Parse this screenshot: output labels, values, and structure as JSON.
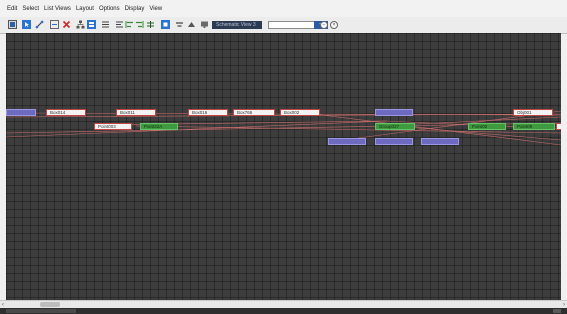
{
  "menu": [
    "Edit",
    "Select",
    "List Views",
    "Layout",
    "Options",
    "Display",
    "View"
  ],
  "toolbar": {
    "view_name": "Schematic View 3",
    "view_select_value": "",
    "icons": [
      "display-floater-icon",
      "select-icon",
      "connect-icon",
      "unlink-icon",
      "delete-icon",
      "hierarchy-mode-icon",
      "references-mode-icon",
      "move-children-icon",
      "align-icon",
      "align-left-icon",
      "align-right-icon",
      "arrange-children-icon",
      "shrink-icon",
      "grow-icon",
      "preferences-icon"
    ]
  },
  "colors": {
    "canvas_bg": "#3d3d3d",
    "wire": "#c46a6a",
    "node_white": "#f3f3f3",
    "node_green": "#3f9a3f",
    "node_purple": "#6d6ac0"
  },
  "nodes": [
    {
      "label": "Box014",
      "type": "white"
    },
    {
      "label": "Box011",
      "type": "white"
    },
    {
      "label": "Box016",
      "type": "white"
    },
    {
      "label": "Box766",
      "type": "white"
    },
    {
      "label": "Box002",
      "type": "white"
    },
    {
      "label": "Obj001",
      "type": "white"
    },
    {
      "label": "Point003",
      "type": "white"
    },
    {
      "label": "Point22A",
      "type": "green"
    },
    {
      "label": "Group027",
      "type": "green"
    },
    {
      "label": "Point02",
      "type": "green"
    },
    {
      "label": "Point09",
      "type": "green"
    },
    {
      "label": "",
      "type": "purple"
    },
    {
      "label": "",
      "type": "purple"
    },
    {
      "label": "",
      "type": "purple"
    },
    {
      "label": "",
      "type": "purple"
    },
    {
      "label": "",
      "type": "purple"
    }
  ],
  "status": {
    "text": ""
  }
}
